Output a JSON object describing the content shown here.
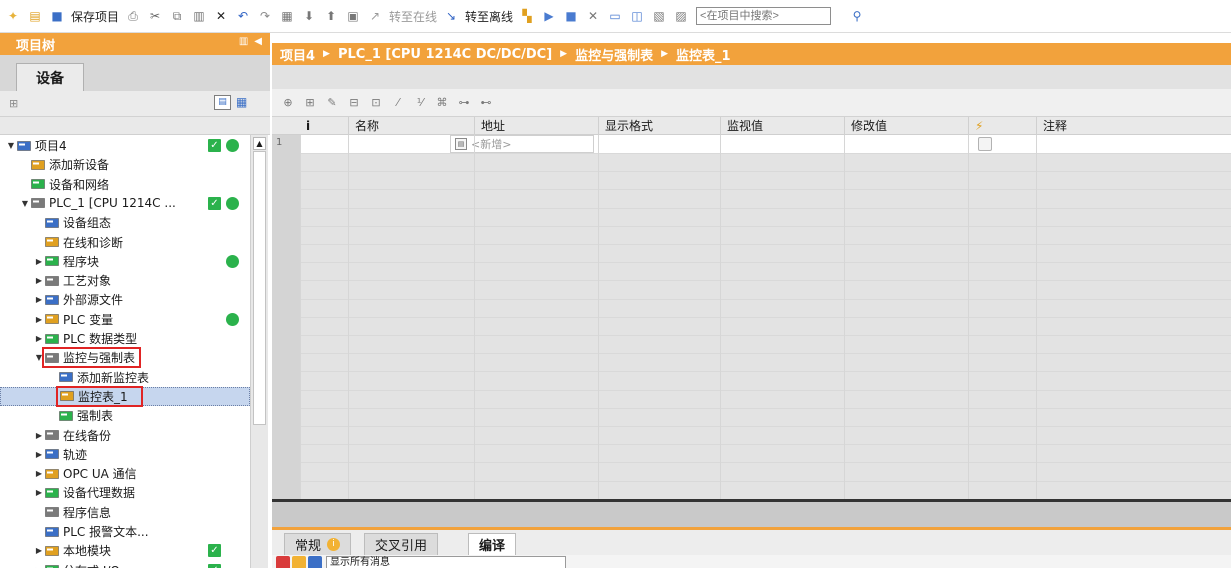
{
  "toolbar": {
    "save_project": "保存项目",
    "go_online": "转至在线",
    "go_offline": "转至离线",
    "search_placeholder": "<在项目中搜索>"
  },
  "left_panel": {
    "title": "项目树",
    "devices_tab": "设备",
    "tree": [
      {
        "label": "项目4",
        "indent": 0,
        "arrow": "▼",
        "icon": "project-icon",
        "check": true,
        "dot": true
      },
      {
        "label": "添加新设备",
        "indent": 1,
        "arrow": "",
        "icon": "add-device-icon"
      },
      {
        "label": "设备和网络",
        "indent": 1,
        "arrow": "",
        "icon": "network-icon"
      },
      {
        "label": "PLC_1 [CPU 1214C ...",
        "indent": 1,
        "arrow": "▼",
        "icon": "plc-icon",
        "check": true,
        "dot": true
      },
      {
        "label": "设备组态",
        "indent": 2,
        "arrow": "",
        "icon": "device-config-icon"
      },
      {
        "label": "在线和诊断",
        "indent": 2,
        "arrow": "",
        "icon": "online-diag-icon"
      },
      {
        "label": "程序块",
        "indent": 2,
        "arrow": "▶",
        "icon": "program-blocks-icon",
        "dot": true
      },
      {
        "label": "工艺对象",
        "indent": 2,
        "arrow": "▶",
        "icon": "tech-objects-icon"
      },
      {
        "label": "外部源文件",
        "indent": 2,
        "arrow": "▶",
        "icon": "external-source-icon"
      },
      {
        "label": "PLC 变量",
        "indent": 2,
        "arrow": "▶",
        "icon": "plc-tags-icon",
        "dot": true
      },
      {
        "label": "PLC 数据类型",
        "indent": 2,
        "arrow": "▶",
        "icon": "plc-datatypes-icon"
      },
      {
        "label": "监控与强制表",
        "indent": 2,
        "arrow": "▼",
        "icon": "watch-force-tables-icon",
        "boxed": true
      },
      {
        "label": "添加新监控表",
        "indent": 3,
        "arrow": "",
        "icon": "add-watch-table-icon"
      },
      {
        "label": "监控表_1",
        "indent": 3,
        "arrow": "",
        "icon": "watch-table-icon",
        "boxed": true,
        "selected": true
      },
      {
        "label": "强制表",
        "indent": 3,
        "arrow": "",
        "icon": "force-table-icon"
      },
      {
        "label": "在线备份",
        "indent": 2,
        "arrow": "▶",
        "icon": "online-backup-icon"
      },
      {
        "label": "轨迹",
        "indent": 2,
        "arrow": "▶",
        "icon": "traces-icon"
      },
      {
        "label": "OPC UA 通信",
        "indent": 2,
        "arrow": "▶",
        "icon": "opcua-icon"
      },
      {
        "label": "设备代理数据",
        "indent": 2,
        "arrow": "▶",
        "icon": "device-proxy-icon"
      },
      {
        "label": "程序信息",
        "indent": 2,
        "arrow": "",
        "icon": "program-info-icon"
      },
      {
        "label": "PLC 报警文本...",
        "indent": 2,
        "arrow": "",
        "icon": "alarm-text-icon"
      },
      {
        "label": "本地模块",
        "indent": 2,
        "arrow": "▶",
        "icon": "local-modules-icon",
        "check": true
      },
      {
        "label": "分布式 I/O",
        "indent": 2,
        "arrow": "▶",
        "icon": "distributed-io-icon",
        "check": true
      }
    ]
  },
  "breadcrumb": [
    "项目4",
    "PLC_1 [CPU 1214C DC/DC/DC]",
    "监控与强制表",
    "监控表_1"
  ],
  "grid": {
    "columns": [
      "i",
      "名称",
      "地址",
      "显示格式",
      "监视值",
      "修改值",
      "注释"
    ],
    "row_number": "1",
    "new_placeholder": "<新增>"
  },
  "bottom_tabs": [
    "常规",
    "交叉引用",
    "编译"
  ],
  "bottom_message_filter": "显示所有消息",
  "colors": {
    "accent": "#f2a23c",
    "ok_green": "#2bb24c",
    "highlight_red": "#e02424"
  }
}
